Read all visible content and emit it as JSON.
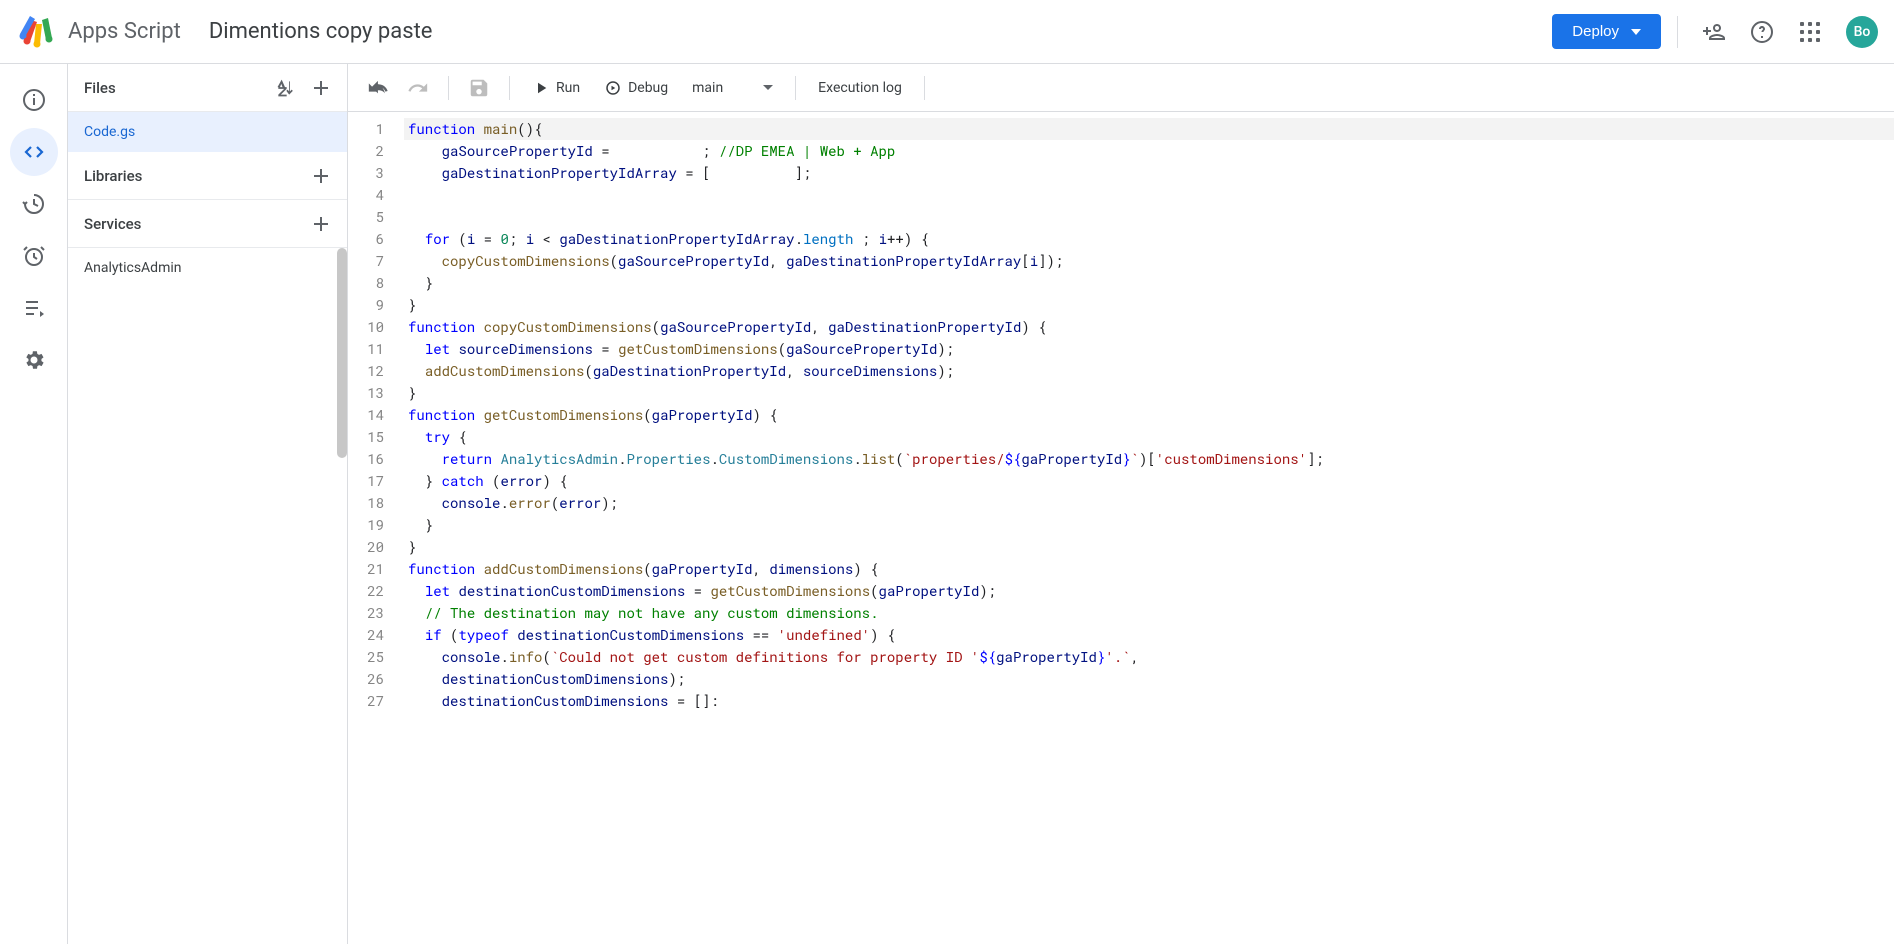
{
  "header": {
    "product_name": "Apps Script",
    "project_title": "Dimentions copy paste",
    "deploy_label": "Deploy",
    "avatar_initials": "Bo"
  },
  "nav_rail": {
    "items": [
      "overview",
      "editor",
      "triggers-log",
      "triggers",
      "executions",
      "settings"
    ]
  },
  "sidebar": {
    "files_label": "Files",
    "files": [
      {
        "name": "Code.gs",
        "active": true
      }
    ],
    "libraries_label": "Libraries",
    "services_label": "Services",
    "services": [
      {
        "name": "AnalyticsAdmin"
      }
    ]
  },
  "toolbar": {
    "run_label": "Run",
    "debug_label": "Debug",
    "function_select": "main",
    "exec_log_label": "Execution log"
  },
  "code": {
    "first_line": 1,
    "lines": [
      [
        [
          "kw",
          "function"
        ],
        [
          "pln",
          " "
        ],
        [
          "fn",
          "main"
        ],
        [
          "pln",
          "(){"
        ]
      ],
      [
        [
          "pln",
          "    "
        ],
        [
          "var",
          "gaSourcePropertyId"
        ],
        [
          "pln",
          " =           ; "
        ],
        [
          "com",
          "//DP EMEA | Web + App"
        ]
      ],
      [
        [
          "pln",
          "    "
        ],
        [
          "var",
          "gaDestinationPropertyIdArray"
        ],
        [
          "pln",
          " = [          ];"
        ]
      ],
      [
        [
          "pln",
          ""
        ]
      ],
      [
        [
          "pln",
          ""
        ]
      ],
      [
        [
          "pln",
          "  "
        ],
        [
          "kw",
          "for"
        ],
        [
          "pln",
          " ("
        ],
        [
          "var",
          "i"
        ],
        [
          "pln",
          " = "
        ],
        [
          "num",
          "0"
        ],
        [
          "pln",
          "; "
        ],
        [
          "var",
          "i"
        ],
        [
          "pln",
          " < "
        ],
        [
          "var",
          "gaDestinationPropertyIdArray"
        ],
        [
          "pln",
          "."
        ],
        [
          "prop",
          "length"
        ],
        [
          "pln",
          " ; "
        ],
        [
          "var",
          "i"
        ],
        [
          "pln",
          "++) {"
        ]
      ],
      [
        [
          "pln",
          "    "
        ],
        [
          "fn",
          "copyCustomDimensions"
        ],
        [
          "pln",
          "("
        ],
        [
          "var",
          "gaSourcePropertyId"
        ],
        [
          "pln",
          ", "
        ],
        [
          "var",
          "gaDestinationPropertyIdArray"
        ],
        [
          "pln",
          "["
        ],
        [
          "var",
          "i"
        ],
        [
          "pln",
          "]);"
        ]
      ],
      [
        [
          "pln",
          "  }"
        ]
      ],
      [
        [
          "pln",
          "}"
        ]
      ],
      [
        [
          "kw",
          "function"
        ],
        [
          "pln",
          " "
        ],
        [
          "fn",
          "copyCustomDimensions"
        ],
        [
          "pln",
          "("
        ],
        [
          "var",
          "gaSourcePropertyId"
        ],
        [
          "pln",
          ", "
        ],
        [
          "var",
          "gaDestinationPropertyId"
        ],
        [
          "pln",
          ") {"
        ]
      ],
      [
        [
          "pln",
          "  "
        ],
        [
          "kw",
          "let"
        ],
        [
          "pln",
          " "
        ],
        [
          "var",
          "sourceDimensions"
        ],
        [
          "pln",
          " = "
        ],
        [
          "fn",
          "getCustomDimensions"
        ],
        [
          "pln",
          "("
        ],
        [
          "var",
          "gaSourcePropertyId"
        ],
        [
          "pln",
          ");"
        ]
      ],
      [
        [
          "pln",
          "  "
        ],
        [
          "fn",
          "addCustomDimensions"
        ],
        [
          "pln",
          "("
        ],
        [
          "var",
          "gaDestinationPropertyId"
        ],
        [
          "pln",
          ", "
        ],
        [
          "var",
          "sourceDimensions"
        ],
        [
          "pln",
          ");"
        ]
      ],
      [
        [
          "pln",
          "}"
        ]
      ],
      [
        [
          "kw",
          "function"
        ],
        [
          "pln",
          " "
        ],
        [
          "fn",
          "getCustomDimensions"
        ],
        [
          "pln",
          "("
        ],
        [
          "var",
          "gaPropertyId"
        ],
        [
          "pln",
          ") {"
        ]
      ],
      [
        [
          "pln",
          "  "
        ],
        [
          "kw",
          "try"
        ],
        [
          "pln",
          " {"
        ]
      ],
      [
        [
          "pln",
          "    "
        ],
        [
          "kw",
          "return"
        ],
        [
          "pln",
          " "
        ],
        [
          "type",
          "AnalyticsAdmin"
        ],
        [
          "pln",
          "."
        ],
        [
          "type",
          "Properties"
        ],
        [
          "pln",
          "."
        ],
        [
          "type",
          "CustomDimensions"
        ],
        [
          "pln",
          "."
        ],
        [
          "fn",
          "list"
        ],
        [
          "pln",
          "("
        ],
        [
          "str",
          "`properties/"
        ],
        [
          "kw",
          "${"
        ],
        [
          "var",
          "gaPropertyId"
        ],
        [
          "kw",
          "}"
        ],
        [
          "str",
          "`"
        ],
        [
          "pln",
          ")["
        ],
        [
          "str",
          "'customDimensions'"
        ],
        [
          "pln",
          "];"
        ]
      ],
      [
        [
          "pln",
          "  } "
        ],
        [
          "kw",
          "catch"
        ],
        [
          "pln",
          " ("
        ],
        [
          "var",
          "error"
        ],
        [
          "pln",
          ") {"
        ]
      ],
      [
        [
          "pln",
          "    "
        ],
        [
          "var",
          "console"
        ],
        [
          "pln",
          "."
        ],
        [
          "fn",
          "error"
        ],
        [
          "pln",
          "("
        ],
        [
          "var",
          "error"
        ],
        [
          "pln",
          ");"
        ]
      ],
      [
        [
          "pln",
          "  }"
        ]
      ],
      [
        [
          "pln",
          "}"
        ]
      ],
      [
        [
          "kw",
          "function"
        ],
        [
          "pln",
          " "
        ],
        [
          "fn",
          "addCustomDimensions"
        ],
        [
          "pln",
          "("
        ],
        [
          "var",
          "gaPropertyId"
        ],
        [
          "pln",
          ", "
        ],
        [
          "var",
          "dimensions"
        ],
        [
          "pln",
          ") {"
        ]
      ],
      [
        [
          "pln",
          "  "
        ],
        [
          "kw",
          "let"
        ],
        [
          "pln",
          " "
        ],
        [
          "var",
          "destinationCustomDimensions"
        ],
        [
          "pln",
          " = "
        ],
        [
          "fn",
          "getCustomDimensions"
        ],
        [
          "pln",
          "("
        ],
        [
          "var",
          "gaPropertyId"
        ],
        [
          "pln",
          ");"
        ]
      ],
      [
        [
          "pln",
          "  "
        ],
        [
          "com",
          "// The destination may not have any custom dimensions."
        ]
      ],
      [
        [
          "pln",
          "  "
        ],
        [
          "kw",
          "if"
        ],
        [
          "pln",
          " ("
        ],
        [
          "kw",
          "typeof"
        ],
        [
          "pln",
          " "
        ],
        [
          "var",
          "destinationCustomDimensions"
        ],
        [
          "pln",
          " == "
        ],
        [
          "str",
          "'undefined'"
        ],
        [
          "pln",
          ") {"
        ]
      ],
      [
        [
          "pln",
          "    "
        ],
        [
          "var",
          "console"
        ],
        [
          "pln",
          "."
        ],
        [
          "fn",
          "info"
        ],
        [
          "pln",
          "("
        ],
        [
          "str",
          "`Could not get custom definitions for property ID '"
        ],
        [
          "kw",
          "${"
        ],
        [
          "var",
          "gaPropertyId"
        ],
        [
          "kw",
          "}"
        ],
        [
          "str",
          "'.`"
        ],
        [
          "pln",
          ", "
        ]
      ],
      [
        [
          "pln",
          "    "
        ],
        [
          "var",
          "destinationCustomDimensions"
        ],
        [
          "pln",
          ");"
        ]
      ],
      [
        [
          "pln",
          "    "
        ],
        [
          "var",
          "destinationCustomDimensions"
        ],
        [
          "pln",
          " = []:"
        ]
      ]
    ],
    "highlighted_line_index": 0
  }
}
